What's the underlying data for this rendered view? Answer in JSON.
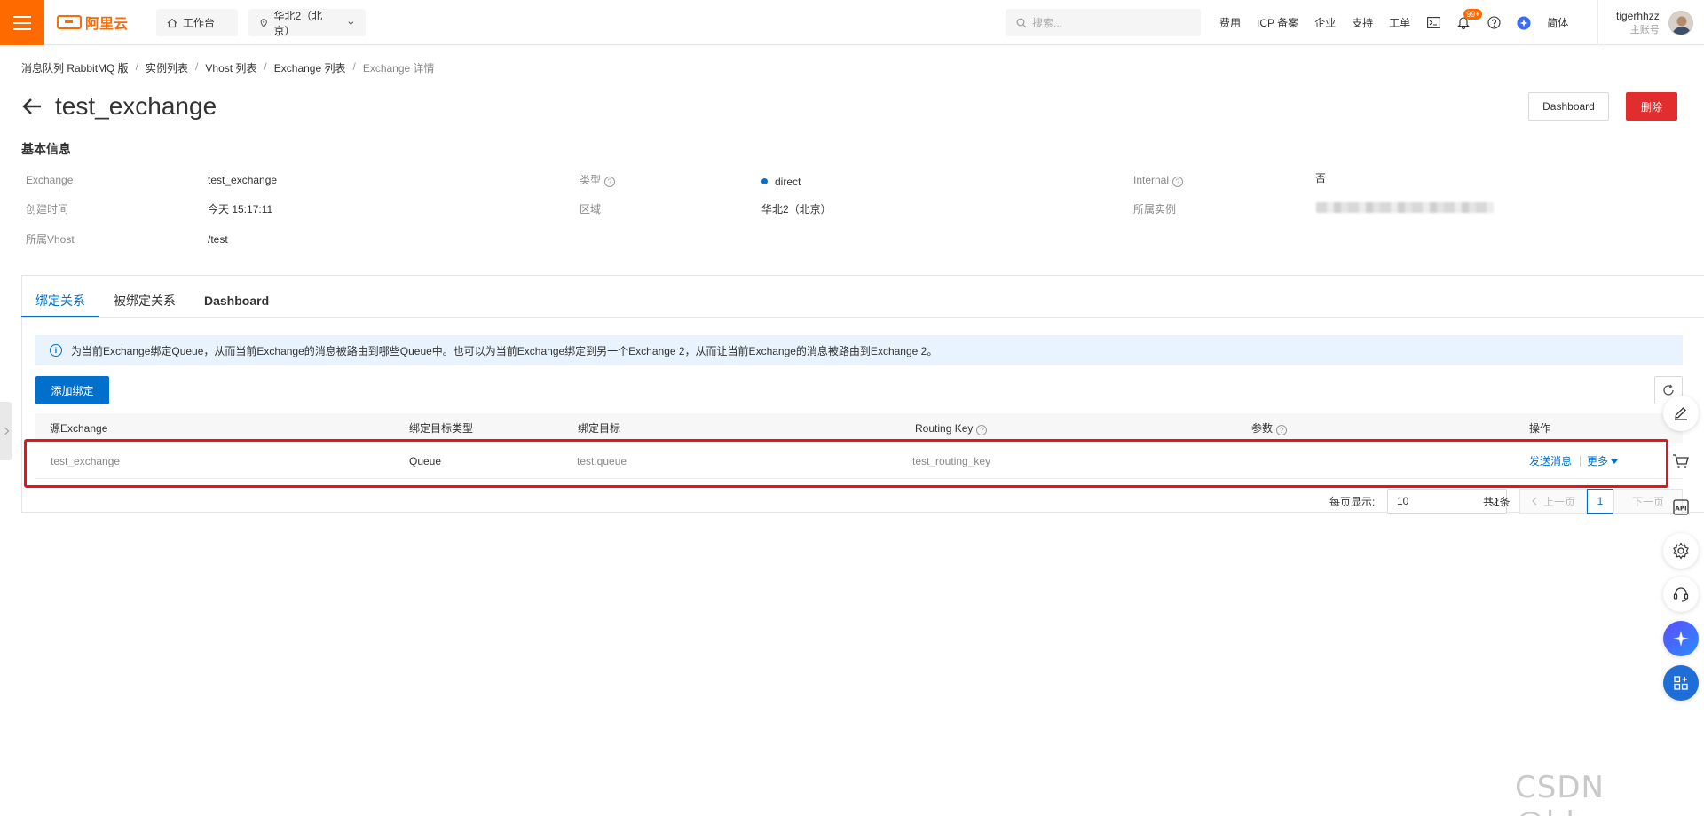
{
  "topbar": {
    "logo_text": "阿里云",
    "workbench_label": "工作台",
    "region_label": "华北2（北京）",
    "search_placeholder": "搜索...",
    "links": [
      "费用",
      "ICP 备案",
      "企业",
      "支持",
      "工单"
    ],
    "notification_badge": "99+",
    "language": "简体",
    "user_name": "tigerhhzz",
    "user_role": "主账号"
  },
  "breadcrumb": [
    "消息队列 RabbitMQ 版",
    "实例列表",
    "Vhost 列表",
    "Exchange 列表",
    "Exchange 详情"
  ],
  "page": {
    "title": "test_exchange",
    "dashboard_button": "Dashboard",
    "delete_button": "删除"
  },
  "basic_info": {
    "section_title": "基本信息",
    "exchange_label": "Exchange",
    "exchange_value": "test_exchange",
    "type_label": "类型",
    "type_value": "direct",
    "internal_label": "Internal",
    "internal_value": "否",
    "created_label": "创建时间",
    "created_value": "今天 15:17:11",
    "region_label": "区域",
    "region_value": "华北2（北京）",
    "instance_label": "所属实例",
    "vhost_label": "所属Vhost",
    "vhost_value": "/test"
  },
  "tabs": [
    "绑定关系",
    "被绑定关系",
    "Dashboard"
  ],
  "alert_text": "为当前Exchange绑定Queue，从而当前Exchange的消息被路由到哪些Queue中。也可以为当前Exchange绑定到另一个Exchange 2，从而让当前Exchange的消息被路由到Exchange 2。",
  "add_binding_button": "添加绑定",
  "table": {
    "headers": [
      "源Exchange",
      "绑定目标类型",
      "绑定目标",
      "Routing Key",
      "参数",
      "操作"
    ],
    "rows": [
      {
        "source": "test_exchange",
        "target_type": "Queue",
        "target": "test.queue",
        "routing_key": "test_routing_key",
        "args": "",
        "op_send": "发送消息",
        "op_more": "更多"
      }
    ]
  },
  "pagination": {
    "page_size_label": "每页显示:",
    "page_size": "10",
    "total": "共1条",
    "prev": "上一页",
    "current": "1",
    "next": "下一页"
  },
  "colors": {
    "brand_orange": "#ff6a00",
    "primary_blue": "#0070cc",
    "danger_red": "#e12d2d",
    "highlight_red": "#e8141a"
  },
  "watermark": "CSDN @hhzz"
}
